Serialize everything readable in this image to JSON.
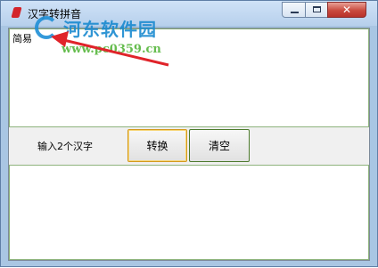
{
  "window": {
    "title": "汉字转拼音",
    "controls": {
      "minimize": "",
      "maximize": "",
      "close": "✕"
    }
  },
  "input": {
    "value": "简易"
  },
  "toolbar": {
    "label": "输入2个汉字",
    "convert_label": "转换",
    "clear_label": "清空"
  },
  "output": {
    "value": ""
  },
  "watermark": {
    "text": "河东软件园",
    "url": "www.pc0359.cn"
  },
  "colors": {
    "arrow": "#e0242a",
    "watermark_blue": "#1a8ad0",
    "watermark_green": "#56b63c",
    "textbox_border": "#8db37c"
  },
  "icons": [
    "app-icon",
    "minimize-icon",
    "maximize-icon",
    "close-icon",
    "arrow-icon",
    "watermark-logo-icon"
  ]
}
